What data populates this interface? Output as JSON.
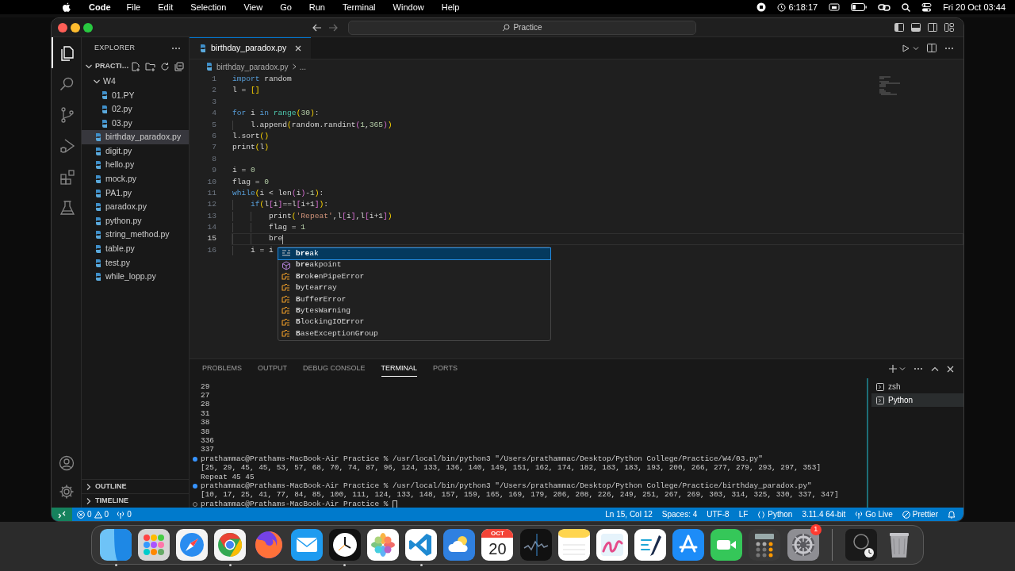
{
  "menu_bar": {
    "app": "Code",
    "items": [
      "File",
      "Edit",
      "Selection",
      "View",
      "Go",
      "Run",
      "Terminal",
      "Window",
      "Help"
    ],
    "timer": "6:18:17",
    "clock": "Fri 20 Oct 03:44"
  },
  "title_bar": {
    "search": "Practice"
  },
  "activity_bar": [
    {
      "kind": "files",
      "selected": true
    },
    {
      "kind": "search",
      "selected": false
    },
    {
      "kind": "source_control",
      "selected": false
    },
    {
      "kind": "run",
      "selected": false
    },
    {
      "kind": "extensions",
      "selected": false
    },
    {
      "kind": "testing",
      "selected": false
    }
  ],
  "sidebar": {
    "title": "EXPLORER",
    "folder": "PRACTI…",
    "tree": [
      {
        "label": "W4",
        "kind": "folder",
        "expanded": true,
        "children": [
          {
            "label": "01.PY",
            "kind": "file",
            "selected": false
          },
          {
            "label": "02.py",
            "kind": "file",
            "selected": false
          },
          {
            "label": "03.py",
            "kind": "file",
            "selected": false
          }
        ]
      },
      {
        "label": "birthday_paradox.py",
        "kind": "file",
        "selected": true
      },
      {
        "label": "digit.py",
        "kind": "file",
        "selected": false
      },
      {
        "label": "hello.py",
        "kind": "file",
        "selected": false
      },
      {
        "label": "mock.py",
        "kind": "file",
        "selected": false
      },
      {
        "label": "PA1.py",
        "kind": "file",
        "selected": false
      },
      {
        "label": "paradox.py",
        "kind": "file",
        "selected": false
      },
      {
        "label": "python.py",
        "kind": "file",
        "selected": false
      },
      {
        "label": "string_method.py",
        "kind": "file",
        "selected": false
      },
      {
        "label": "table.py",
        "kind": "file",
        "selected": false
      },
      {
        "label": "test.py",
        "kind": "file",
        "selected": false
      },
      {
        "label": "while_lopp.py",
        "kind": "file",
        "selected": false
      }
    ],
    "sections": [
      {
        "label": "OUTLINE",
        "expanded": false
      },
      {
        "label": "TIMELINE",
        "expanded": false
      }
    ]
  },
  "editor": {
    "tabs": [
      {
        "label": "birthday_paradox.py",
        "selected": true
      }
    ],
    "breadcrumb": [
      "birthday_paradox.py",
      "..."
    ],
    "lines": [
      {
        "number": "1",
        "current": false,
        "tokens": [
          {
            "text": "import",
            "kind": "keyword"
          },
          {
            "text": " random",
            "kind": "plain"
          }
        ]
      },
      {
        "number": "2",
        "current": false,
        "tokens": [
          {
            "text": "l = ",
            "kind": "plain"
          },
          {
            "text": "[]",
            "kind": "bracket1"
          }
        ]
      },
      {
        "number": "3",
        "current": false
      },
      {
        "number": "4",
        "current": false,
        "tokens": [
          {
            "text": "for",
            "kind": "keyword"
          },
          {
            "text": " i ",
            "kind": "plain"
          },
          {
            "text": "in ",
            "kind": "keyword"
          },
          {
            "text": "range",
            "kind": "builtin"
          },
          {
            "text": "(",
            "kind": "bracket1"
          },
          {
            "text": "30",
            "kind": "number"
          },
          {
            "text": ")",
            "kind": "bracket1"
          },
          {
            "text": ":",
            "kind": "plain"
          }
        ]
      },
      {
        "number": "5",
        "current": false,
        "tokens": [
          {
            "text": "    l.append",
            "kind": "plain"
          },
          {
            "text": "(",
            "kind": "bracket1"
          },
          {
            "text": "random.randint",
            "kind": "plain"
          },
          {
            "text": "(",
            "kind": "bracket2"
          },
          {
            "text": "1",
            "kind": "number"
          },
          {
            "text": ",",
            "kind": "plain"
          },
          {
            "text": "365",
            "kind": "number"
          },
          {
            "text": ")",
            "kind": "bracket2"
          },
          {
            "text": ")",
            "kind": "bracket1"
          }
        ]
      },
      {
        "number": "6",
        "current": false,
        "tokens": [
          {
            "text": "l.sort",
            "kind": "plain"
          },
          {
            "text": "()",
            "kind": "bracket1"
          }
        ]
      },
      {
        "number": "7",
        "current": false,
        "tokens": [
          {
            "text": "print",
            "kind": "plain"
          },
          {
            "text": "(",
            "kind": "bracket1"
          },
          {
            "text": "l",
            "kind": "plain"
          },
          {
            "text": ")",
            "kind": "bracket1"
          }
        ]
      },
      {
        "number": "8",
        "current": false
      },
      {
        "number": "9",
        "current": false,
        "tokens": [
          {
            "text": "i = ",
            "kind": "plain"
          },
          {
            "text": "0",
            "kind": "number"
          }
        ]
      },
      {
        "number": "10",
        "current": false,
        "tokens": [
          {
            "text": "flag = ",
            "kind": "plain"
          },
          {
            "text": "0",
            "kind": "number"
          }
        ]
      },
      {
        "number": "11",
        "current": false,
        "tokens": [
          {
            "text": "while",
            "kind": "keyword"
          },
          {
            "text": "(",
            "kind": "bracket1"
          },
          {
            "text": "i < len",
            "kind": "plain"
          },
          {
            "text": "(",
            "kind": "bracket2"
          },
          {
            "text": "i",
            "kind": "plain"
          },
          {
            "text": ")",
            "kind": "bracket2"
          },
          {
            "text": "-",
            "kind": "plain"
          },
          {
            "text": "1",
            "kind": "number"
          },
          {
            "text": ")",
            "kind": "bracket1"
          },
          {
            "text": ":",
            "kind": "plain"
          }
        ]
      },
      {
        "number": "12",
        "current": false,
        "tokens": [
          {
            "text": "    if",
            "kind": "keyword"
          },
          {
            "text": "(",
            "kind": "bracket1"
          },
          {
            "text": "l",
            "kind": "plain"
          },
          {
            "text": "[",
            "kind": "bracket2"
          },
          {
            "text": "i",
            "kind": "plain"
          },
          {
            "text": "]",
            "kind": "bracket2"
          },
          {
            "text": "==l",
            "kind": "plain"
          },
          {
            "text": "[",
            "kind": "bracket2"
          },
          {
            "text": "i+1",
            "kind": "plain"
          },
          {
            "text": "]",
            "kind": "bracket2"
          },
          {
            "text": ")",
            "kind": "bracket1"
          },
          {
            "text": ":",
            "kind": "plain"
          }
        ]
      },
      {
        "number": "13",
        "current": false,
        "tokens": [
          {
            "text": "        print",
            "kind": "plain"
          },
          {
            "text": "(",
            "kind": "bracket1"
          },
          {
            "text": "'Repeat'",
            "kind": "string"
          },
          {
            "text": ",l",
            "kind": "plain"
          },
          {
            "text": "[",
            "kind": "bracket2"
          },
          {
            "text": "i",
            "kind": "plain"
          },
          {
            "text": "]",
            "kind": "bracket2"
          },
          {
            "text": ",l",
            "kind": "plain"
          },
          {
            "text": "[",
            "kind": "bracket2"
          },
          {
            "text": "i+1",
            "kind": "plain"
          },
          {
            "text": "]",
            "kind": "bracket2"
          },
          {
            "text": ")",
            "kind": "bracket1"
          }
        ]
      },
      {
        "number": "14",
        "current": false,
        "tokens": [
          {
            "text": "        flag = ",
            "kind": "plain"
          },
          {
            "text": "1",
            "kind": "number"
          }
        ]
      },
      {
        "number": "15",
        "current": true,
        "tokens": [
          {
            "text": "        bre",
            "kind": "plain"
          }
        ]
      },
      {
        "number": "16",
        "current": false,
        "tokens": [
          {
            "text": "    i = i",
            "kind": "plain"
          }
        ]
      }
    ],
    "suggestions": [
      {
        "label": "**bre**ak",
        "kind": "keyword",
        "selected": true
      },
      {
        "label": "**bre**akpoint",
        "kind": "function",
        "selected": false
      },
      {
        "label": "**Br**ok**e**nPipeError",
        "kind": "class",
        "selected": false
      },
      {
        "label": "**b**ytea**r**ray",
        "kind": "class",
        "selected": false
      },
      {
        "label": "**B**uffe**r**Error",
        "kind": "class",
        "selected": false
      },
      {
        "label": "**B**ytesWa**r**ning",
        "kind": "class",
        "selected": false
      },
      {
        "label": "**B**lockingIOE**r**ror",
        "kind": "class",
        "selected": false
      },
      {
        "label": "**B**aseExceptionG**r**oup",
        "kind": "class",
        "selected": false
      }
    ]
  },
  "panel": {
    "tabs": [
      {
        "label": "PROBLEMS",
        "selected": false
      },
      {
        "label": "OUTPUT",
        "selected": false
      },
      {
        "label": "DEBUG CONSOLE",
        "selected": false
      },
      {
        "label": "TERMINAL",
        "selected": true
      },
      {
        "label": "PORTS",
        "selected": false
      }
    ],
    "terminal_lines": [
      {
        "text": "29",
        "kind": "output"
      },
      {
        "text": "27",
        "kind": "output"
      },
      {
        "text": "28",
        "kind": "output"
      },
      {
        "text": "31",
        "kind": "output"
      },
      {
        "text": "38",
        "kind": "output"
      },
      {
        "text": "38",
        "kind": "output"
      },
      {
        "text": "336",
        "kind": "output"
      },
      {
        "text": "337",
        "kind": "output"
      },
      {
        "text": "prathammac@Prathams-MacBook-Air Practice % /usr/local/bin/python3 \"/Users/prathammac/Desktop/Python College/Practice/W4/03.py\"",
        "kind": "prompt",
        "done": true
      },
      {
        "text": "[25, 29, 45, 45, 53, 57, 68, 70, 74, 87, 96, 124, 133, 136, 140, 149, 151, 162, 174, 182, 183, 183, 193, 200, 266, 277, 279, 293, 297, 353]",
        "kind": "output"
      },
      {
        "text": "Repeat 45 45",
        "kind": "output"
      },
      {
        "text": "prathammac@Prathams-MacBook-Air Practice % /usr/local/bin/python3 \"/Users/prathammac/Desktop/Python College/Practice/birthday_paradox.py\"",
        "kind": "prompt",
        "done": true
      },
      {
        "text": "[10, 17, 25, 41, 77, 84, 85, 100, 111, 124, 133, 148, 157, 159, 165, 169, 179, 206, 208, 226, 249, 251, 267, 269, 303, 314, 325, 330, 337, 347]",
        "kind": "output"
      },
      {
        "text": "prathammac@Prathams-MacBook-Air Practice % ",
        "kind": "prompt",
        "done": false,
        "cursor": true
      }
    ],
    "terminals": [
      {
        "label": "zsh",
        "selected": false
      },
      {
        "label": "Python",
        "selected": true
      }
    ]
  },
  "status_bar": {
    "errors": "0",
    "warnings": "0",
    "ports": "0",
    "items": [
      {
        "text": "Ln 15, Col 12",
        "kind": "text"
      },
      {
        "text": "Spaces: 4",
        "kind": "text"
      },
      {
        "text": "UTF-8",
        "kind": "text"
      },
      {
        "text": "LF",
        "kind": "text"
      },
      {
        "text": "Python",
        "kind": "language"
      },
      {
        "text": "3.11.4 64-bit",
        "kind": "text"
      },
      {
        "text": "Go Live",
        "kind": "live"
      },
      {
        "text": "Prettier",
        "kind": "prettier"
      }
    ]
  },
  "dock": [
    {
      "kind": "finder",
      "running": true
    },
    {
      "kind": "launchpad",
      "running": false
    },
    {
      "kind": "safari",
      "running": false
    },
    {
      "kind": "chrome",
      "running": true
    },
    {
      "kind": "firefox",
      "running": false
    },
    {
      "kind": "mail",
      "running": false
    },
    {
      "kind": "clock",
      "running": true
    },
    {
      "kind": "photos",
      "running": false
    },
    {
      "kind": "vscode",
      "running": true
    },
    {
      "kind": "weather",
      "running": false
    },
    {
      "kind": "calendar",
      "running": false,
      "month": "OCT",
      "day": "20"
    },
    {
      "kind": "stocks",
      "running": false
    },
    {
      "kind": "notes",
      "running": false
    },
    {
      "kind": "freeform",
      "running": false
    },
    {
      "kind": "scribble",
      "running": false
    },
    {
      "kind": "appstore",
      "running": false
    },
    {
      "kind": "facetime",
      "running": false
    },
    {
      "kind": "calculator",
      "running": false
    },
    {
      "kind": "settings",
      "running": false,
      "badge": "1"
    },
    {
      "kind": "widget",
      "running": false
    },
    {
      "kind": "trash",
      "running": false
    }
  ]
}
